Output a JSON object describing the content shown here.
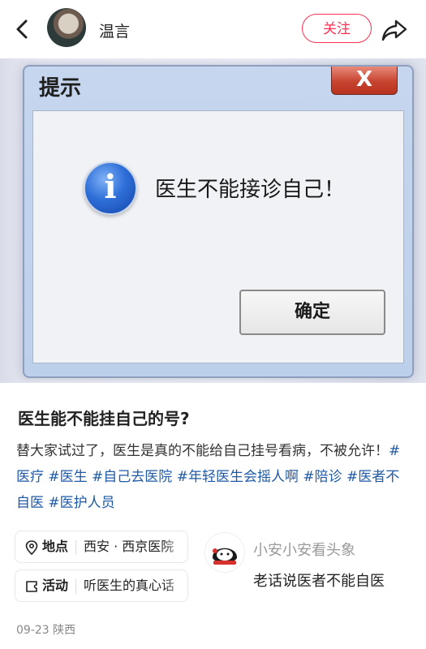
{
  "header": {
    "username": "温言",
    "follow_label": "关注",
    "icons": [
      "back-arrow-icon",
      "avatar",
      "share-icon"
    ]
  },
  "photo": {
    "dialog_title": "提示",
    "dialog_close": "X",
    "dialog_icon": "i",
    "dialog_message": "医生不能接诊自己！",
    "dialog_ok": "确定"
  },
  "post": {
    "title": "医生能不能挂自己的号?",
    "desc_text": "替大家试过了，医生是真的不能给自己挂号看病，不被允许！",
    "tags": [
      "#医疗",
      "#医生",
      "#自己去医院",
      "#年轻医生会摇人啊",
      "#陪诊",
      "#医者不自医",
      "#医护人员"
    ]
  },
  "chips": {
    "location_label": "地点",
    "location_value": "西安 · 西京医院",
    "activity_label": "活动",
    "activity_value": "听医生的真心话"
  },
  "card": {
    "title": "小安小安看头象",
    "subtitle": "老话说医者不能自医"
  },
  "meta": {
    "date_location": "09-23 陕西"
  },
  "colors": {
    "accent": "#ff2f53",
    "tag": "#1f5aa6"
  }
}
